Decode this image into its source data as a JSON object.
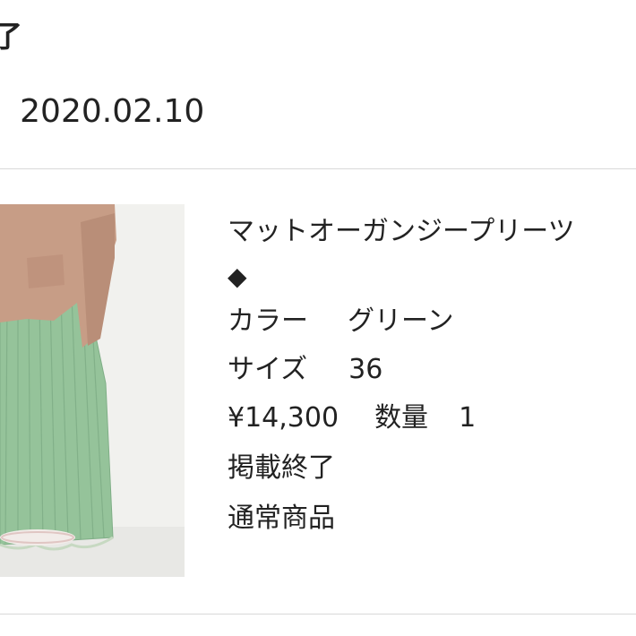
{
  "header": {
    "status_fragment": "了",
    "date_prefix": ":",
    "date_value": "2020.02.10"
  },
  "product": {
    "image_icon": "product-photo",
    "title": "マットオーガンジープリーツ",
    "title_marker": "◆",
    "color_label": "カラー",
    "color_value": "グリーン",
    "size_label": "サイズ",
    "size_value": "36",
    "price": "¥14,300",
    "quantity_label": "数量",
    "quantity_value": "1",
    "listing_status": "掲載終了",
    "product_type": "通常商品"
  },
  "colors": {
    "divider": "#d9d9d9",
    "text": "#222222",
    "skirt": "#8fbf95",
    "sweater": "#c49a82"
  }
}
